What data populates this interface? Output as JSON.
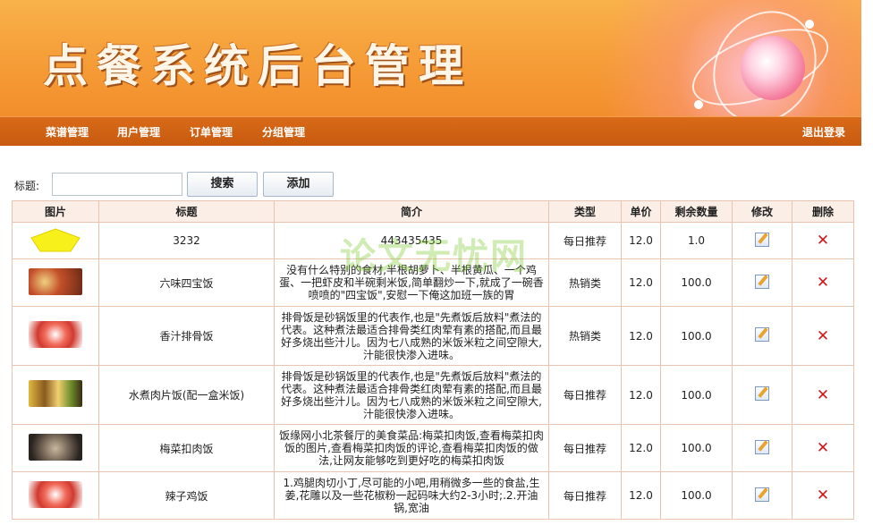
{
  "banner": {
    "title": "点餐系统后台管理"
  },
  "nav": {
    "items": [
      "菜谱管理",
      "用户管理",
      "订单管理",
      "分组管理"
    ],
    "logout": "退出登录"
  },
  "search": {
    "label": "标题:",
    "value": "",
    "search_button": "搜索",
    "add_button": "添加"
  },
  "table": {
    "headers": [
      "图片",
      "标题",
      "简介",
      "类型",
      "单价",
      "剩余数量",
      "修改",
      "删除"
    ],
    "rows": [
      {
        "image": "yellow-pentagon",
        "title": "3232",
        "desc": "443435435",
        "type": "每日推荐",
        "price": "12.0",
        "stock": "1.0"
      },
      {
        "image": "dish-photo",
        "title": "六味四宝饭",
        "desc": "没有什么特别的食材,半根胡萝卜、半根黄瓜、一个鸡蛋、一把虾皮和半碗剩米饭,简单翻炒一下,就成了一碗香喷喷的\"四宝饭\",安慰一下俺这加班一族的胃",
        "type": "热销类",
        "price": "12.0",
        "stock": "100.0"
      },
      {
        "image": "dish-photo",
        "title": "香汁排骨饭",
        "desc": "排骨饭是砂锅饭里的代表作,也是\"先煮饭后放料\"煮法的代表。这种煮法最适合排骨类红肉荤有素的搭配,而且最好多烧出些汁儿。因为七八成熟的米饭米粒之间空隙大,汁能很快渗入进味。",
        "type": "热销类",
        "price": "12.0",
        "stock": "100.0"
      },
      {
        "image": "dish-photo",
        "title": "水煮肉片饭(配一盒米饭)",
        "desc": "排骨饭是砂锅饭里的代表作,也是\"先煮饭后放料\"煮法的代表。这种煮法最适合排骨类红肉荤有素的搭配,而且最好多烧出些汁儿。因为七八成熟的米饭米粒之间空隙大,汁能很快渗入进味。",
        "type": "每日推荐",
        "price": "12.0",
        "stock": "100.0"
      },
      {
        "image": "dish-photo",
        "title": "梅菜扣肉饭",
        "desc": "饭缘网小北茶餐厅的美食菜品:梅菜扣肉饭,查看梅菜扣肉饭的图片,查看梅菜扣肉饭的评论,查看梅菜扣肉饭的做法,让网友能够吃到更好吃的梅菜扣肉饭",
        "type": "每日推荐",
        "price": "12.0",
        "stock": "100.0"
      },
      {
        "image": "dish-photo",
        "title": "辣子鸡饭",
        "desc": "1.鸡腿肉切小丁,尽可能的小吧,用稍微多一些的食盐,生姜,花雕以及一些花椒粉一起码味大约2-3小时;.2.开油锅,宽油",
        "type": "每日推荐",
        "price": "12.0",
        "stock": "100.0"
      }
    ]
  },
  "watermark": "论文无忧网",
  "colors": {
    "banner": "#f6a03a",
    "navbar": "#c85a10",
    "header_bg": "#fbeee6",
    "delete": "#d0171b"
  }
}
